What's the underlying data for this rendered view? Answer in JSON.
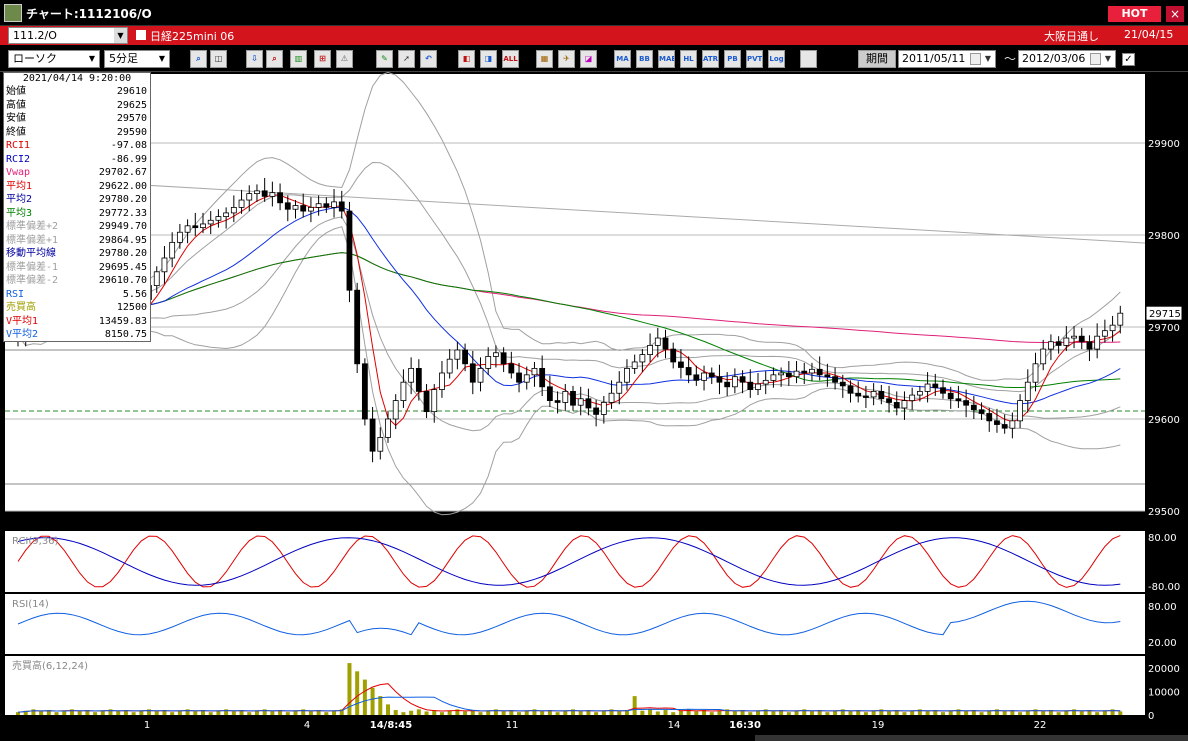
{
  "window": {
    "title": "チャート:1112106/O",
    "hot_label": "HOT",
    "close_glyph": "×"
  },
  "symbolbar": {
    "symbol": "111.2/O",
    "name": "日経225mini 06",
    "market": "大阪日通し",
    "date": "21/04/15"
  },
  "toolbar": {
    "chart_type": "ローソク",
    "interval": "5分足",
    "buttons": [
      "zoom-icon",
      "split-icon",
      "arrow-down-icon",
      "search-icon",
      "bar-chart-icon",
      "trend-icon",
      "warning-icon",
      "pencil-icon",
      "cursor-icon",
      "back-icon",
      "candle-icon",
      "candle2-icon",
      "all-icon",
      "grid-icon",
      "tool-icon",
      "color-icon"
    ],
    "ind_buttons": [
      "MA",
      "BB",
      "MAE",
      "HL",
      "ATR",
      "PB",
      "PVT",
      "Log"
    ],
    "all_label": "ALL",
    "log_label": "Log",
    "period_label": "期間",
    "date_from": "2011/05/11",
    "tilde": "～",
    "date_to": "2012/03/06",
    "check_glyph": "✓"
  },
  "info": {
    "datetime": "2021/04/14 9:20:00",
    "rows": [
      {
        "label": "始値",
        "value": "29610",
        "color": "#000000"
      },
      {
        "label": "高値",
        "value": "29625",
        "color": "#000000"
      },
      {
        "label": "安値",
        "value": "29570",
        "color": "#000000"
      },
      {
        "label": "終値",
        "value": "29590",
        "color": "#000000"
      },
      {
        "label": "RCI1",
        "value": "-97.08",
        "color": "#e00000"
      },
      {
        "label": "RCI2",
        "value": "-86.99",
        "color": "#0000c0"
      },
      {
        "label": "Vwap",
        "value": "29702.67",
        "color": "#e0207a"
      },
      {
        "label": "平均1",
        "value": "29622.00",
        "color": "#e00000"
      },
      {
        "label": "平均2",
        "value": "29780.20",
        "color": "#0000a0"
      },
      {
        "label": "平均3",
        "value": "29772.33",
        "color": "#008000"
      },
      {
        "label": "標準偏差+2",
        "value": "29949.70",
        "color": "#a0a0a0"
      },
      {
        "label": "標準偏差+1",
        "value": "29864.95",
        "color": "#a0a0a0"
      },
      {
        "label": "移動平均線",
        "value": "29780.20",
        "color": "#0000a0"
      },
      {
        "label": "標準偏差-1",
        "value": "29695.45",
        "color": "#a0a0a0"
      },
      {
        "label": "標準偏差-2",
        "value": "29610.70",
        "color": "#a0a0a0"
      },
      {
        "label": "RSI",
        "value": "5.56",
        "color": "#1060e0"
      },
      {
        "label": "売買高",
        "value": "12500",
        "color": "#a0a000"
      },
      {
        "label": "V平均1",
        "value": "13459.83",
        "color": "#e00000"
      },
      {
        "label": "V平均2",
        "value": "8150.75",
        "color": "#1060e0"
      }
    ]
  },
  "chart_data": [
    {
      "type": "candlestick",
      "y_ticks": [
        "29900",
        "29800",
        "29700",
        "29600",
        "29500"
      ],
      "ylim": [
        29500,
        29975
      ],
      "last_price": "29715",
      "x_labels": [
        "1",
        "4",
        "14/8:45",
        "11",
        "14",
        "16:30",
        "19",
        "22"
      ],
      "colors": {
        "up": "#ffffff",
        "down": "#000000",
        "ma1": "#e00000",
        "ma2": "#1030e0",
        "ma3": "#008000",
        "vwap": "#e0207a",
        "band": "#a0a0a0"
      },
      "closes": [
        29690,
        29710,
        29720,
        29735,
        29728,
        29740,
        29738,
        29745,
        29732,
        29726,
        29718,
        29720,
        29715,
        29706,
        29712,
        29720,
        29730,
        29745,
        29760,
        29775,
        29792,
        29803,
        29810,
        29808,
        29812,
        29816,
        29820,
        29824,
        29830,
        29838,
        29845,
        29848,
        29842,
        29846,
        29835,
        29828,
        29832,
        29826,
        29830,
        29834,
        29830,
        29836,
        29826,
        29740,
        29660,
        29600,
        29565,
        29580,
        29600,
        29620,
        29640,
        29655,
        29630,
        29608,
        29632,
        29650,
        29665,
        29675,
        29660,
        29640,
        29655,
        29668,
        29672,
        29660,
        29650,
        29640,
        29648,
        29655,
        29635,
        29620,
        29618,
        29630,
        29615,
        29622,
        29612,
        29605,
        29618,
        29628,
        29640,
        29655,
        29662,
        29670,
        29680,
        29688,
        29676,
        29662,
        29656,
        29648,
        29642,
        29650,
        29646,
        29640,
        29635,
        29646,
        29640,
        29632,
        29638,
        29642,
        29648,
        29650,
        29646,
        29652,
        29650,
        29654,
        29648,
        29646,
        29640,
        29636,
        29628,
        29625,
        29624,
        29630,
        29622,
        29618,
        29612,
        29620,
        29626,
        29630,
        29638,
        29634,
        29628,
        29622,
        29620,
        29615,
        29610,
        29606,
        29598,
        29594,
        29590,
        29598,
        29620,
        29640,
        29660,
        29676,
        29684,
        29680,
        29688,
        29690,
        29684,
        29676,
        29690,
        29696,
        29702,
        29715
      ]
    },
    {
      "type": "line",
      "title": "RCI(9,36)",
      "y_ticks": [
        "80.00",
        "-80.00"
      ],
      "ylim": [
        -100,
        100
      ]
    },
    {
      "type": "line",
      "title": "RSI(14)",
      "y_ticks": [
        "80.00",
        "20.00"
      ],
      "ylim": [
        0,
        100
      ]
    },
    {
      "type": "bar",
      "title": "売買高(6,12,24)",
      "y_ticks": [
        "20000",
        "10000",
        "0"
      ],
      "ylim": [
        0,
        25000
      ]
    }
  ]
}
